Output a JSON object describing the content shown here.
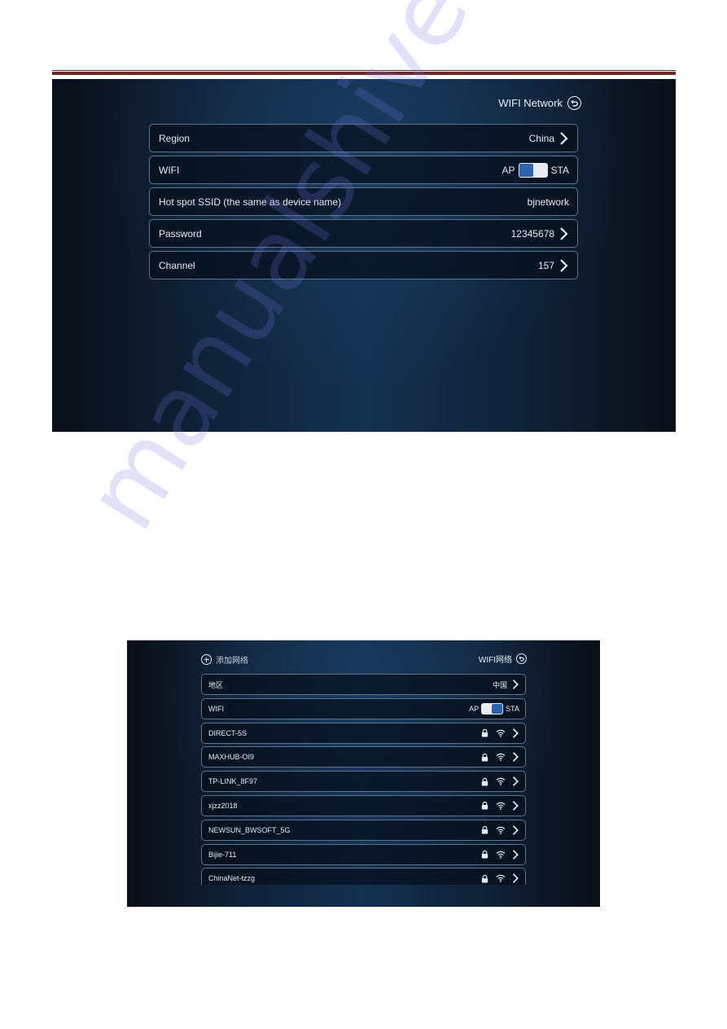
{
  "screen1": {
    "title": "WIFI Network",
    "rows": [
      {
        "label": "Region",
        "value": "China",
        "has_chevron": true
      },
      {
        "label": "WIFI",
        "toggle_left": "AP",
        "toggle_right": "STA",
        "toggle_state": "AP"
      },
      {
        "label": "Hot spot SSID (the same as device name)",
        "value": "bjnetwork",
        "has_chevron": false
      },
      {
        "label": "Password",
        "value": "12345678",
        "has_chevron": true
      },
      {
        "label": "Channel",
        "value": "157",
        "has_chevron": true
      }
    ]
  },
  "screen2": {
    "title": "WIFI网络",
    "add_network": "添加网络",
    "region": {
      "label": "地区",
      "value": "中国"
    },
    "wifi": {
      "label": "WIFI",
      "toggle_left": "AP",
      "toggle_right": "STA",
      "toggle_state": "STA"
    },
    "networks": [
      {
        "ssid": "DIRECT-5S",
        "secured": true
      },
      {
        "ssid": "MAXHUB-OI9",
        "secured": true
      },
      {
        "ssid": "TP-LINK_8F97",
        "secured": true
      },
      {
        "ssid": "xjzz2018",
        "secured": true
      },
      {
        "ssid": "NEWSUN_BWSOFT_5G",
        "secured": true
      },
      {
        "ssid": "Bijie-711",
        "secured": true
      },
      {
        "ssid": "ChinaNet-tzzg",
        "secured": true
      }
    ]
  },
  "colors": {
    "header_rule": "#6b2a2a",
    "toggle_accent": "#2a65ad",
    "row_border": "#5f7288"
  },
  "watermark": "manualshive.com"
}
